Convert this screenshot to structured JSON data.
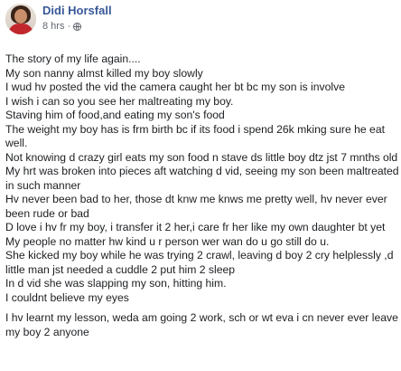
{
  "post": {
    "author": "Didi Horsfall",
    "time": "8 hrs",
    "separator": "·",
    "privacy_icon": "globe-icon",
    "lines": [
      "The story of my life again....",
      "My son nanny almst killed my boy slowly",
      "I wud hv posted the vid the camera caught her bt bc my son is involve",
      "I wish i can so you see her maltreating my boy.",
      "Staving him of food,and eating my son's food",
      "The weight my boy has is frm birth bc if its food i spend 26k mking sure he eat well.",
      "Not knowing d crazy girl eats my son food n stave ds little boy dtz jst 7 mnths old",
      "My hrt was broken into pieces aft watching d vid, seeing my son been maltreated in such manner",
      "Hv never been bad to her, those dt knw me knws me pretty well, hv never ever been rude or bad",
      "D love i hv fr my boy, i transfer it 2 her,i care fr her like my own daughter bt yet",
      "My people no matter hw kind u r person wer wan do u go still do u.",
      "She kicked my boy while he was trying 2 crawl, leaving d boy 2 cry helplessly ,d little man jst needed a cuddle 2 put him 2 sleep",
      "In d vid she was slapping my son, hitting him.",
      "I couldnt believe my eyes"
    ],
    "last_paragraph": "I hv learnt my lesson, weda am going 2 work, sch or wt eva i cn never ever leave my boy 2 anyone"
  }
}
